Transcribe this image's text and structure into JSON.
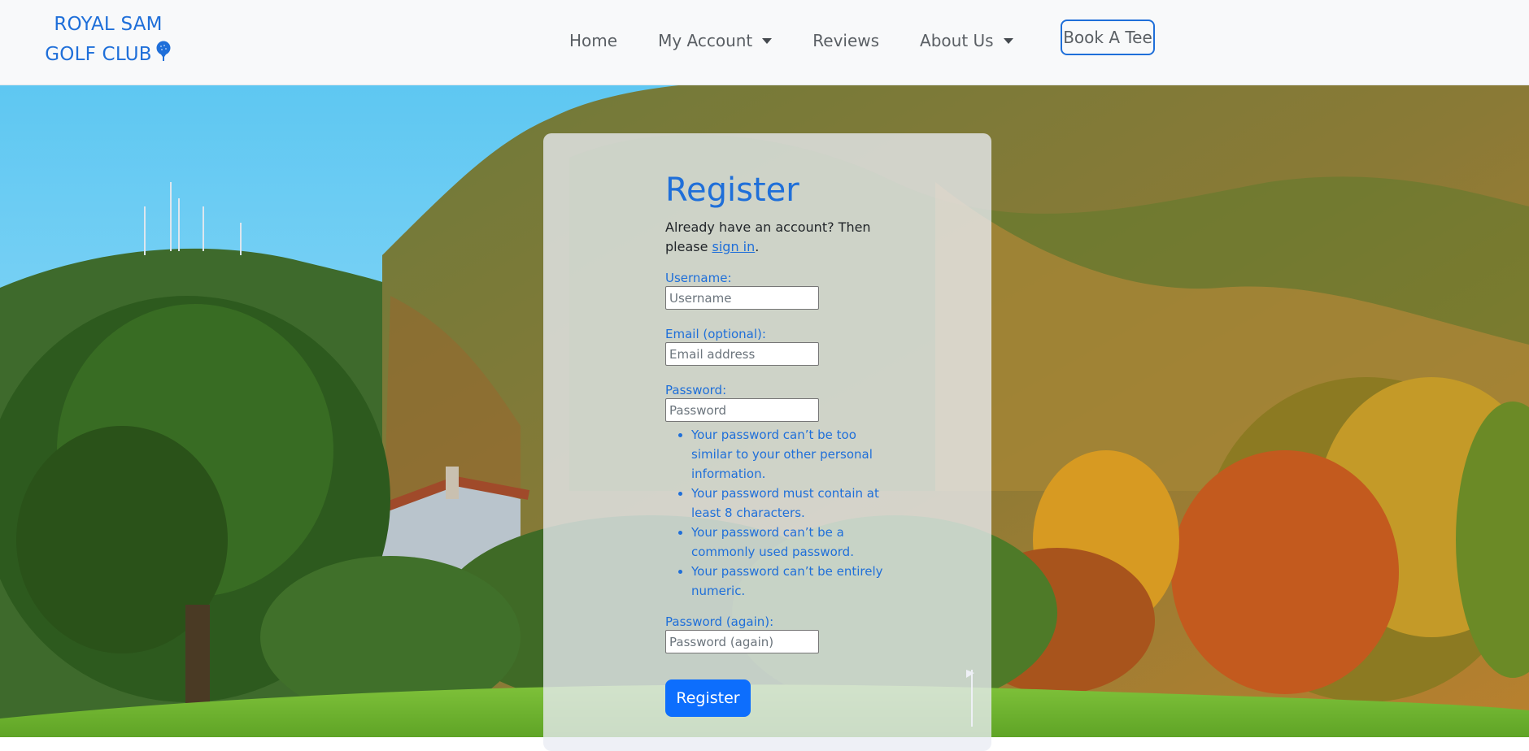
{
  "brand": {
    "line1": "ROYAL SAM",
    "line2": "GOLF CLUB",
    "icon": "golf-ball-icon"
  },
  "nav": {
    "home": "Home",
    "my_account": "My Account",
    "reviews": "Reviews",
    "about_us": "About Us",
    "book_tee": "Book A Tee"
  },
  "form": {
    "title": "Register",
    "intro_prefix": "Already have an account? Then please ",
    "signin_link": "sign in",
    "intro_suffix": ".",
    "username_label": "Username:",
    "username_placeholder": "Username",
    "email_label": "Email (optional):",
    "email_placeholder": "Email address",
    "password_label": "Password:",
    "password_placeholder": "Password",
    "help": [
      "Your password can’t be too similar to your other personal information.",
      "Your password must contain at least 8 characters.",
      "Your password can’t be a commonly used password.",
      "Your password can’t be entirely numeric."
    ],
    "password2_label": "Password (again):",
    "password2_placeholder": "Password (again)",
    "submit_label": "Register"
  },
  "colors": {
    "accent": "#1f6fd9",
    "button": "#0d6efd",
    "navbar_bg": "#f8f9fa"
  }
}
